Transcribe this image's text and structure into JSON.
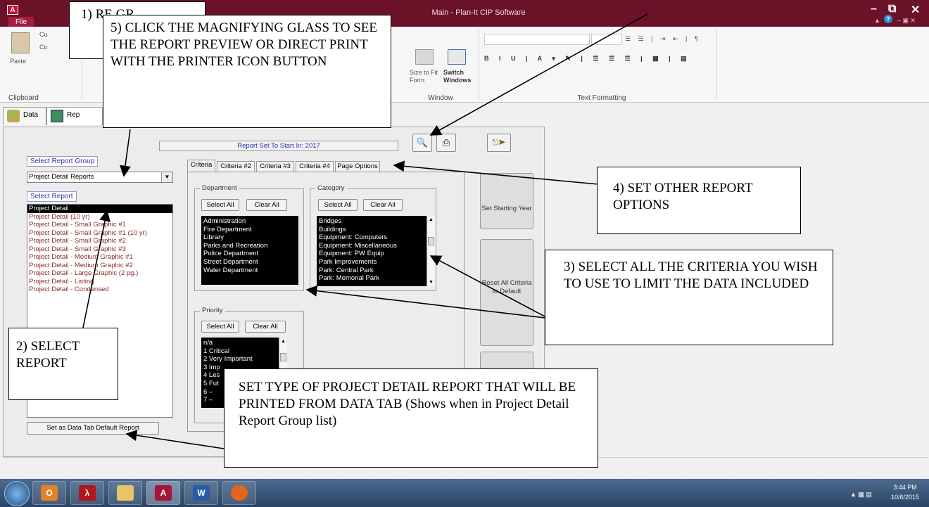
{
  "window": {
    "title": "Main - Plan-It CIP Software",
    "app_icon": "A",
    "file_tab": "File",
    "ribbon_tab_letter": "H"
  },
  "ribbon": {
    "clipboard_label": "Clipboard",
    "paste_label": "Paste",
    "cut_label": "Cu",
    "copy_label": "Co",
    "size_to_fit": "Size to Fit Form",
    "switch_windows": "Switch Windows",
    "window_label": "Window",
    "text_formatting_label": "Text Formatting"
  },
  "app_tabs": {
    "data": "Data",
    "reports": "Rep"
  },
  "report_set": "Report Set To Start In: 2017",
  "select_group_label": "Select Report Group",
  "report_group_value": "Project Detail Reports",
  "select_report_label": "Select Report",
  "reports": [
    "Project Detail",
    "Project Detail (10 yr)",
    "Project Detail - Small Graphic #1",
    "Project Detail - Small Graphic #1 (10 yr)",
    "Project Detail - Small Graphic #2",
    "Project Detail - Small Graphic #3",
    "Project Detail - Medium Graphic #1",
    "Project Detail - Medium Graphic #2",
    "Project Detail - Large Graphic (2 pg.)",
    "Project Detail - Listing",
    "Project Detail - Condensed"
  ],
  "set_default_button": "Set as Data Tab Default Report",
  "criteria_tabs": [
    "Criteria #1",
    "Criteria #2",
    "Criteria #3",
    "Criteria #4",
    "Page Options"
  ],
  "department": {
    "legend": "Department",
    "select_all": "Select All",
    "clear_all": "Clear All",
    "items": [
      "Administration",
      "Fire Department",
      "Library",
      "Parks and Recreation",
      "Police Department",
      "Street Department",
      "Water Department"
    ]
  },
  "category": {
    "legend": "Category",
    "select_all": "Select All",
    "clear_all": "Clear All",
    "items": [
      "Bridges",
      "Buildings",
      "Equipment: Computers",
      "Equipment: Miscellaneous",
      "Equipment: PW Equip",
      "Park Improvements",
      "Park: Central Park",
      "Park: Memorial Park"
    ]
  },
  "priority": {
    "legend": "Priority",
    "select_all": "Select All",
    "clear_all": "Clear All",
    "items": [
      "n/a",
      "1 Critical",
      "2 Very Important",
      "3 Imp",
      "4 Les",
      "5 Fut",
      "6 –",
      "7 –"
    ]
  },
  "side_buttons": {
    "set_starting_year": "Set Starting Year",
    "reset_all": "Reset All Criteria to Default"
  },
  "annotations": {
    "a1": "1) RE GR",
    "a5": "5) CLICK THE MAGNIFYING GLASS TO SEE THE REPORT PREVIEW OR DIRECT PRINT WITH THE PRINTER ICON BUTTON",
    "a4": "4) SET OTHER REPORT OPTIONS",
    "a3": "3) SELECT ALL THE CRITERIA YOU WISH TO USE TO LIMIT THE DATA INCLUDED",
    "a2": "2) SELECT REPORT",
    "a6": "SET TYPE OF PROJECT DETAIL REPORT THAT WILL BE PRINTED FROM DATA TAB (Shows when in Project Detail Report Group list)"
  },
  "taskbar": {
    "time": "3:44 PM",
    "date": "10/6/2015"
  },
  "colors": {
    "titlebar": "#6b1229",
    "list_text": "#8b2a2a",
    "blue_label": "#2a33b7"
  }
}
